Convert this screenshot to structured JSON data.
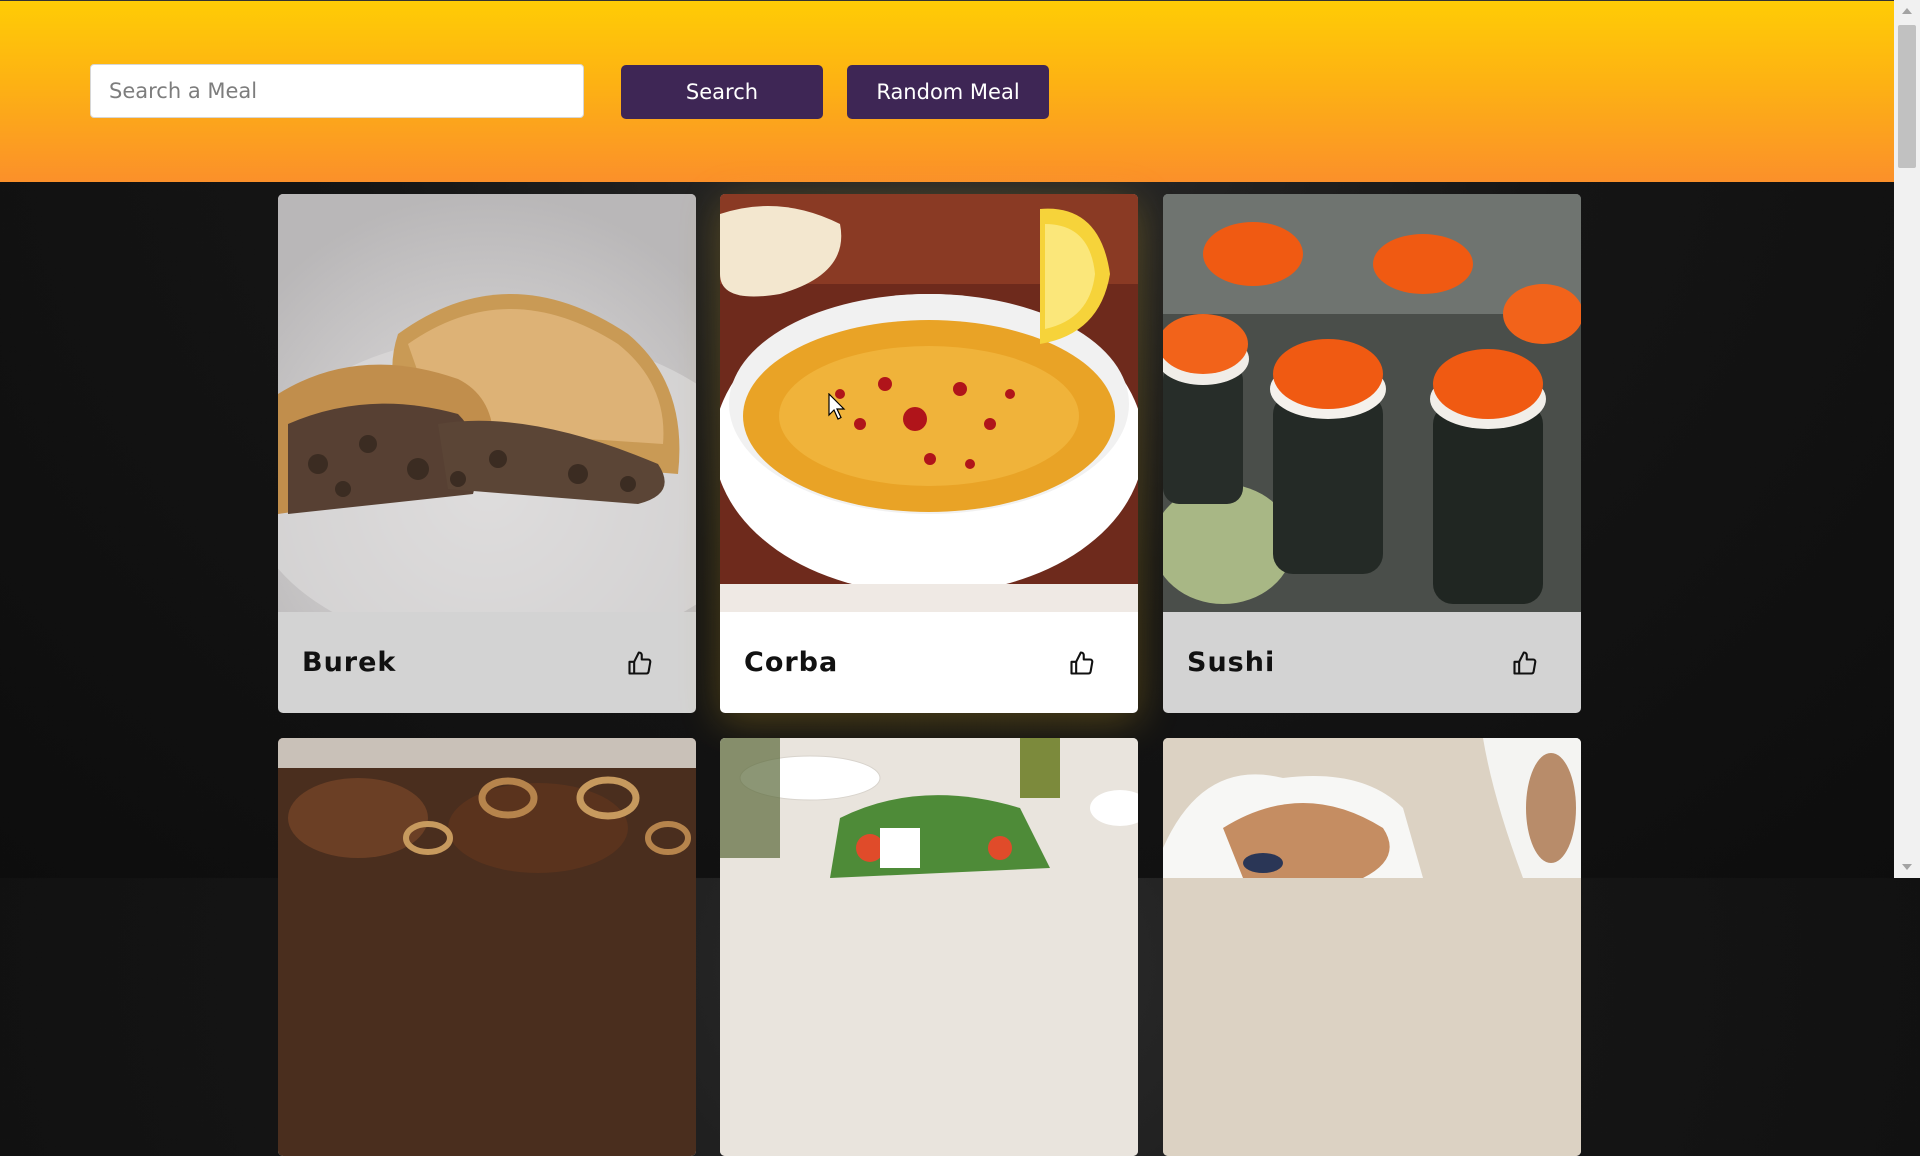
{
  "header": {
    "search_placeholder": "Search a Meal",
    "search_label": "Search",
    "random_label": "Random Meal"
  },
  "meals": [
    {
      "name": "Burek",
      "like_icon": "thumbs-up-icon"
    },
    {
      "name": "Corba",
      "like_icon": "thumbs-up-icon"
    },
    {
      "name": "Sushi",
      "like_icon": "thumbs-up-icon"
    }
  ],
  "colors": {
    "header_top": "#ffcc05",
    "header_bottom": "#fb902a",
    "button_bg": "#3e2655",
    "card_bg": "#d3d3d3",
    "card_highlight_bg": "#ffffff"
  }
}
